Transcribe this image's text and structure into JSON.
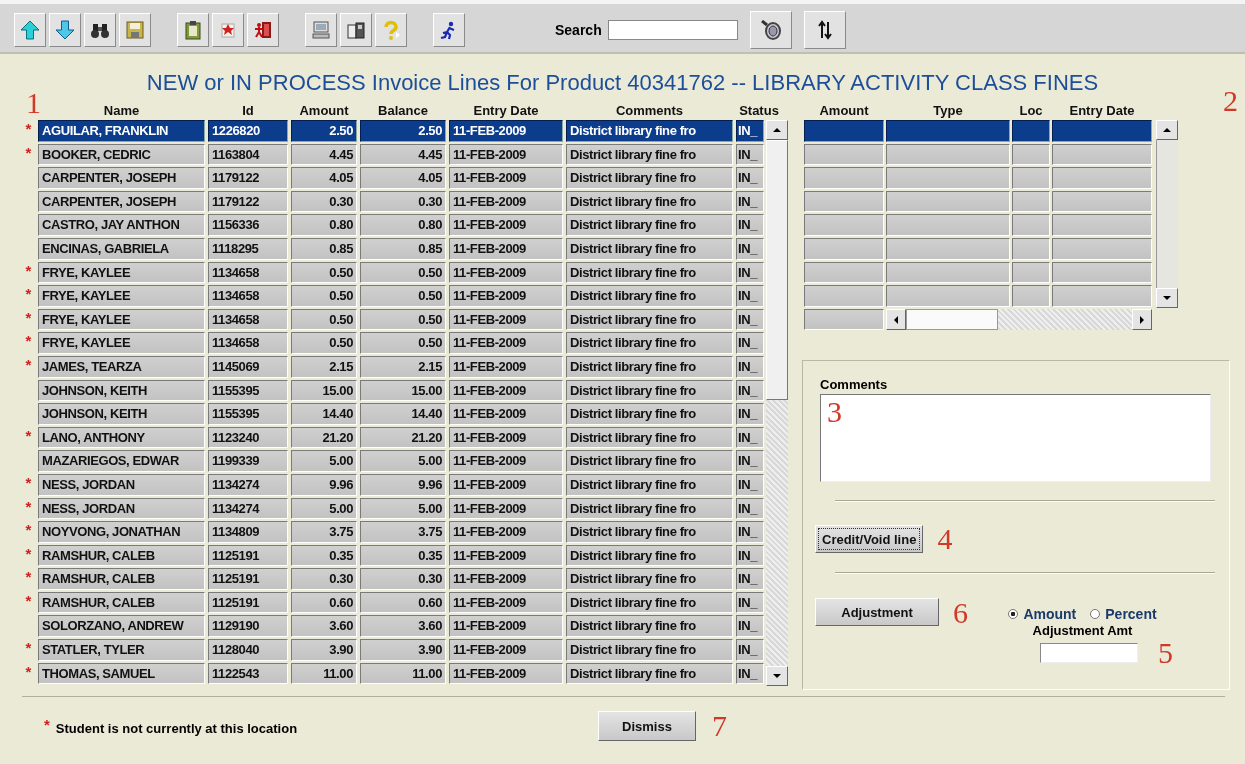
{
  "toolbar": {
    "groups": [
      [
        {
          "kind": "up"
        },
        {
          "kind": "down"
        },
        {
          "kind": "binoculars"
        },
        {
          "kind": "save"
        }
      ],
      [
        {
          "kind": "clipboard"
        },
        {
          "kind": "note"
        },
        {
          "kind": "exit"
        }
      ],
      [
        {
          "kind": "computer"
        },
        {
          "kind": "book"
        },
        {
          "kind": "help"
        }
      ],
      [
        {
          "kind": "runner"
        }
      ]
    ],
    "search": {
      "label": "Search"
    },
    "tools": [
      {
        "kind": "lens"
      },
      {
        "kind": "sort"
      }
    ]
  },
  "title": "NEW or IN PROCESS Invoice Lines For Product 40341762 -- LIBRARY ACTIVITY CLASS FINES",
  "invoice_table": {
    "callout": "1",
    "columns": [
      "Name",
      "Id",
      "Amount",
      "Balance",
      "Entry Date",
      "Comments",
      "Status"
    ],
    "rows": [
      {
        "flagged": true,
        "selected": true,
        "cells": [
          "AGUILAR, FRANKLIN",
          "1226820",
          "2.50",
          "2.50",
          "11-FEB-2009",
          "District library fine fro",
          "IN_"
        ]
      },
      {
        "flagged": true,
        "selected": false,
        "cells": [
          "BOOKER, CEDRIC",
          "1163804",
          "4.45",
          "4.45",
          "11-FEB-2009",
          "District library fine fro",
          "IN_"
        ]
      },
      {
        "flagged": false,
        "selected": false,
        "cells": [
          "CARPENTER, JOSEPH",
          "1179122",
          "4.05",
          "4.05",
          "11-FEB-2009",
          "District library fine fro",
          "IN_"
        ]
      },
      {
        "flagged": false,
        "selected": false,
        "cells": [
          "CARPENTER, JOSEPH",
          "1179122",
          "0.30",
          "0.30",
          "11-FEB-2009",
          "District library fine fro",
          "IN_"
        ]
      },
      {
        "flagged": false,
        "selected": false,
        "cells": [
          "CASTRO, JAY ANTHON",
          "1156336",
          "0.80",
          "0.80",
          "11-FEB-2009",
          "District library fine fro",
          "IN_"
        ]
      },
      {
        "flagged": false,
        "selected": false,
        "cells": [
          "ENCINAS, GABRIELA",
          "1118295",
          "0.85",
          "0.85",
          "11-FEB-2009",
          "District library fine fro",
          "IN_"
        ]
      },
      {
        "flagged": true,
        "selected": false,
        "cells": [
          "FRYE, KAYLEE",
          "1134658",
          "0.50",
          "0.50",
          "11-FEB-2009",
          "District library fine fro",
          "IN_"
        ]
      },
      {
        "flagged": true,
        "selected": false,
        "cells": [
          "FRYE, KAYLEE",
          "1134658",
          "0.50",
          "0.50",
          "11-FEB-2009",
          "District library fine fro",
          "IN_"
        ]
      },
      {
        "flagged": true,
        "selected": false,
        "cells": [
          "FRYE, KAYLEE",
          "1134658",
          "0.50",
          "0.50",
          "11-FEB-2009",
          "District library fine fro",
          "IN_"
        ]
      },
      {
        "flagged": true,
        "selected": false,
        "cells": [
          "FRYE, KAYLEE",
          "1134658",
          "0.50",
          "0.50",
          "11-FEB-2009",
          "District library fine fro",
          "IN_"
        ]
      },
      {
        "flagged": true,
        "selected": false,
        "cells": [
          "JAMES, TEARZA",
          "1145069",
          "2.15",
          "2.15",
          "11-FEB-2009",
          "District library fine fro",
          "IN_"
        ]
      },
      {
        "flagged": false,
        "selected": false,
        "cells": [
          "JOHNSON, KEITH",
          "1155395",
          "15.00",
          "15.00",
          "11-FEB-2009",
          "District library fine fro",
          "IN_"
        ]
      },
      {
        "flagged": false,
        "selected": false,
        "cells": [
          "JOHNSON, KEITH",
          "1155395",
          "14.40",
          "14.40",
          "11-FEB-2009",
          "District library fine fro",
          "IN_"
        ]
      },
      {
        "flagged": true,
        "selected": false,
        "cells": [
          "LANO, ANTHONY",
          "1123240",
          "21.20",
          "21.20",
          "11-FEB-2009",
          "District library fine fro",
          "IN_"
        ]
      },
      {
        "flagged": false,
        "selected": false,
        "cells": [
          "MAZARIEGOS, EDWAR",
          "1199339",
          "5.00",
          "5.00",
          "11-FEB-2009",
          "District library fine fro",
          "IN_"
        ]
      },
      {
        "flagged": true,
        "selected": false,
        "cells": [
          "NESS, JORDAN",
          "1134274",
          "9.96",
          "9.96",
          "11-FEB-2009",
          "District library fine fro",
          "IN_"
        ]
      },
      {
        "flagged": true,
        "selected": false,
        "cells": [
          "NESS, JORDAN",
          "1134274",
          "5.00",
          "5.00",
          "11-FEB-2009",
          "District library fine fro",
          "IN_"
        ]
      },
      {
        "flagged": true,
        "selected": false,
        "cells": [
          "NOYVONG, JONATHAN",
          "1134809",
          "3.75",
          "3.75",
          "11-FEB-2009",
          "District library fine fro",
          "IN_"
        ]
      },
      {
        "flagged": true,
        "selected": false,
        "cells": [
          "RAMSHUR, CALEB",
          "1125191",
          "0.35",
          "0.35",
          "11-FEB-2009",
          "District library fine fro",
          "IN_"
        ]
      },
      {
        "flagged": true,
        "selected": false,
        "cells": [
          "RAMSHUR, CALEB",
          "1125191",
          "0.30",
          "0.30",
          "11-FEB-2009",
          "District library fine fro",
          "IN_"
        ]
      },
      {
        "flagged": true,
        "selected": false,
        "cells": [
          "RAMSHUR, CALEB",
          "1125191",
          "0.60",
          "0.60",
          "11-FEB-2009",
          "District library fine fro",
          "IN_"
        ]
      },
      {
        "flagged": false,
        "selected": false,
        "cells": [
          "SOLORZANO, ANDREW",
          "1129190",
          "3.60",
          "3.60",
          "11-FEB-2009",
          "District library fine fro",
          "IN_"
        ]
      },
      {
        "flagged": true,
        "selected": false,
        "cells": [
          "STATLER, TYLER",
          "1128040",
          "3.90",
          "3.90",
          "11-FEB-2009",
          "District library fine fro",
          "IN_"
        ]
      },
      {
        "flagged": true,
        "selected": false,
        "cells": [
          "THOMAS, SAMUEL",
          "1122543",
          "11.00",
          "11.00",
          "11-FEB-2009",
          "District library fine fro",
          "IN_"
        ]
      }
    ]
  },
  "detail_table": {
    "callout": "2",
    "columns": [
      "Amount",
      "Type",
      "Loc",
      "Entry Date"
    ],
    "rows": [
      {
        "selected": true
      },
      {
        "selected": false
      },
      {
        "selected": false
      },
      {
        "selected": false
      },
      {
        "selected": false
      },
      {
        "selected": false
      },
      {
        "selected": false
      },
      {
        "selected": false
      }
    ]
  },
  "action_panel": {
    "comments": {
      "label": "Comments",
      "callout": "3"
    },
    "credit_button": {
      "label": "Credit/Void line",
      "callout": "4"
    },
    "adjustment_button": {
      "label": "Adjustment",
      "callout": "6"
    },
    "modes": [
      {
        "label": "Amount",
        "selected": true
      },
      {
        "label": "Percent",
        "selected": false
      }
    ],
    "adjustment_amt": {
      "label": "Adjustment Amt",
      "callout": "5"
    }
  },
  "footer": {
    "marker": "*",
    "note": "Student is not currently at this location",
    "dismiss": {
      "label": "Dismiss",
      "callout": "7"
    }
  }
}
